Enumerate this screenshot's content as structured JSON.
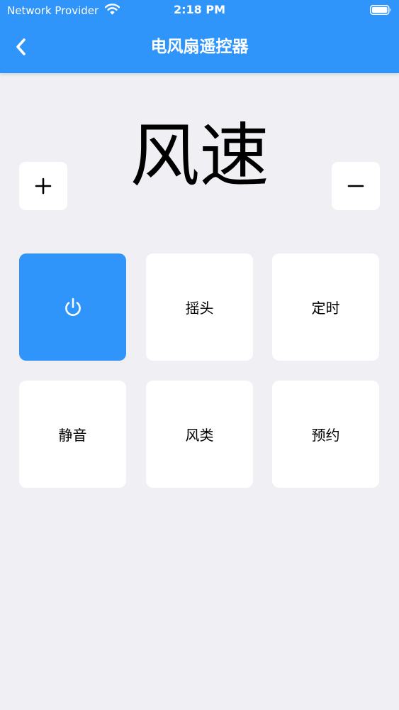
{
  "status_bar": {
    "carrier": "Network Provider",
    "time": "2:18 PM",
    "wifi_icon": "wifi-icon",
    "battery_icon": "battery-icon"
  },
  "nav": {
    "back_icon": "chevron-left-icon",
    "title": "电风扇遥控器"
  },
  "speed": {
    "label": "风速",
    "increase_icon": "plus-icon",
    "decrease_icon": "minus-icon"
  },
  "buttons": [
    {
      "label": "",
      "icon": "power-icon",
      "active": true
    },
    {
      "label": "摇头"
    },
    {
      "label": "定时"
    },
    {
      "label": "静音"
    },
    {
      "label": "风类"
    },
    {
      "label": "预约"
    }
  ],
  "colors": {
    "accent": "#2f95fa",
    "background": "#efeff4",
    "tile": "#ffffff"
  }
}
